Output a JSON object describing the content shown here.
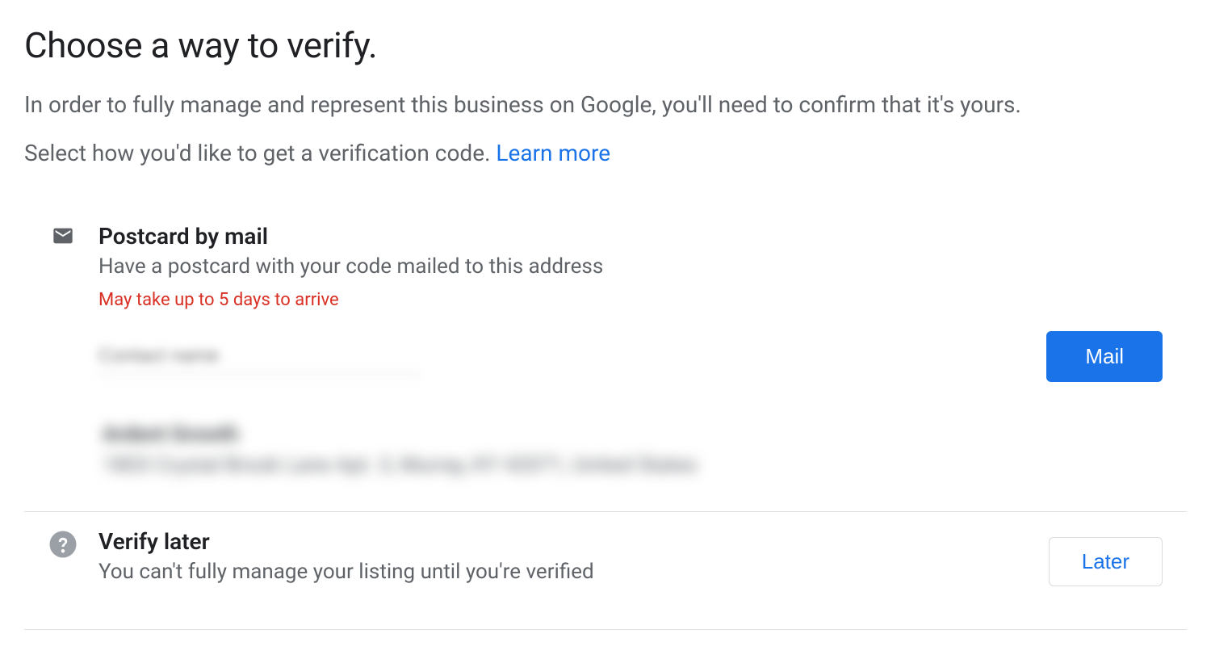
{
  "header": {
    "title": "Choose a way to verify.",
    "subtitle": "In order to fully manage and represent this business on Google, you'll need to confirm that it's yours.",
    "instruction": "Select how you'd like to get a verification code. ",
    "learn_more": "Learn more"
  },
  "postcard_option": {
    "title": "Postcard by mail",
    "description": "Have a postcard with your code mailed to this address",
    "warning": "May take up to 5 days to arrive",
    "contact_placeholder": "Contact name",
    "button_label": "Mail",
    "address_name": "Ardent Growth",
    "address_line": "1803 Crystal Brook Lane Apt. 3, Murray, KY 42071, United States"
  },
  "later_option": {
    "title": "Verify later",
    "description": "You can't fully manage your listing until you're verified",
    "button_label": "Later"
  }
}
